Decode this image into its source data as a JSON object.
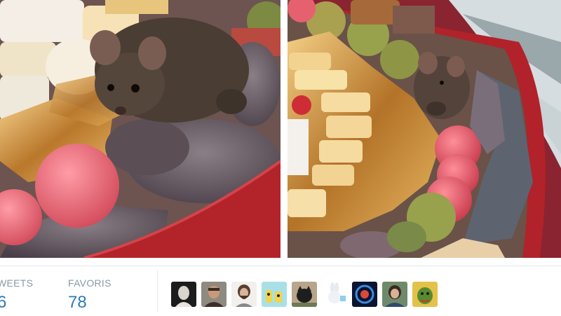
{
  "tweet_media": {
    "left_photo_icon": "photo-mouse-in-candy-box-closeup",
    "right_photo_icon": "photo-mouse-in-candy-box-wide"
  },
  "stats": {
    "retweets_label": "WEETS",
    "retweets_value": "6",
    "favorites_label": "FAVORIS",
    "favorites_value": "78"
  },
  "favorited_by": [
    {
      "icon": "avatar-dark-portrait"
    },
    {
      "icon": "avatar-man-portrait"
    },
    {
      "icon": "avatar-bearded-man"
    },
    {
      "icon": "avatar-cartoon-figures"
    },
    {
      "icon": "avatar-cat"
    },
    {
      "icon": "avatar-white-rabbit"
    },
    {
      "icon": "avatar-blue-circle-logo"
    },
    {
      "icon": "avatar-woman-portrait"
    },
    {
      "icon": "avatar-green-illustration"
    }
  ],
  "colors": {
    "link_blue": "#2b7bb9",
    "label_gray": "#8899a6",
    "border": "#e1e8ed"
  }
}
